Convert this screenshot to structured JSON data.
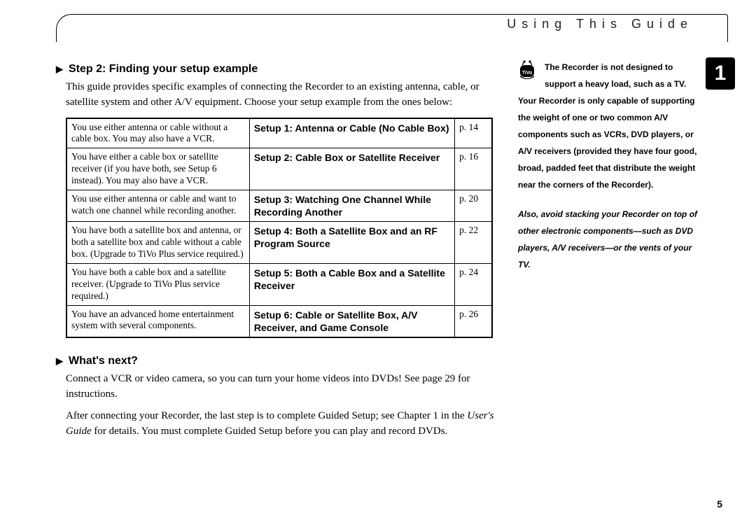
{
  "header": {
    "title": "Using This Guide"
  },
  "chapter_badge": "1",
  "page_number": "5",
  "section1": {
    "heading": "Step 2: Finding your setup example",
    "intro": "This guide provides specific examples of connecting the Recorder to an existing antenna, cable, or satellite system and other A/V equipment. Choose your setup example from the ones below:"
  },
  "setups": [
    {
      "desc": "You use either antenna or cable without a cable box. You may also have a VCR.",
      "label": "Setup 1: Antenna or Cable (No Cable Box)",
      "page": "p. 14"
    },
    {
      "desc": "You have either a cable box or satellite receiver (if you have both, see Setup 6 instead). You may also have a VCR.",
      "label": "Setup 2: Cable Box or Satellite Receiver",
      "page": "p. 16"
    },
    {
      "desc": "You use either antenna or cable and want to watch one channel while recording another.",
      "label": "Setup 3: Watching One Channel While Recording Another",
      "page": "p. 20"
    },
    {
      "desc": "You have both a satellite box and antenna, or both a satellite box and cable without a cable box. (Upgrade to TiVo Plus service required.)",
      "label": "Setup 4: Both a Satellite Box and an RF Program Source",
      "page": "p. 22"
    },
    {
      "desc": "You have both a cable box and a satellite receiver. (Upgrade to TiVo Plus service required.)",
      "label": "Setup 5: Both a Cable Box and a Satellite Receiver",
      "page": "p. 24"
    },
    {
      "desc": "You have an advanced home entertainment system with several components.",
      "label": "Setup 6: Cable or Satellite Box, A/V Receiver, and Game Console",
      "page": "p. 26"
    }
  ],
  "section2": {
    "heading": "What's next?",
    "p1": "Connect a VCR or video camera, so you can turn your home videos into DVDs! See page 29 for instructions.",
    "p2a": "After connecting your Recorder, the last step is to complete Guided Setup; see Chapter 1 in the ",
    "p2_italic": "User's Guide",
    "p2b": " for details. You must complete Guided Setup before you can play and record DVDs."
  },
  "sidebar": {
    "p1": "The Recorder is not designed to support a heavy load, such as a TV. Your Recorder is only capable of supporting the weight of one or two common A/V components such as VCRs, DVD players, or A/V receivers (provided they have four good, broad, padded feet that distribute the weight near the corners of the Recorder).",
    "p1_line1": "The Recorder is not designed to",
    "p1_line2": "support a heavy load, such as a TV.",
    "p1_rest": "Your Recorder is only capable of supporting the weight of one or two common A/V components such as VCRs, DVD players, or A/V receivers (provided they have four good, broad, padded feet that distribute the weight near the corners of the Recorder).",
    "p2": "Also, avoid stacking your Recorder on top of other electronic components—such as DVD players, A/V receivers—or the vents of your TV."
  },
  "icons": {
    "tivo": "tivo-logo-icon",
    "arrow": "▶"
  }
}
